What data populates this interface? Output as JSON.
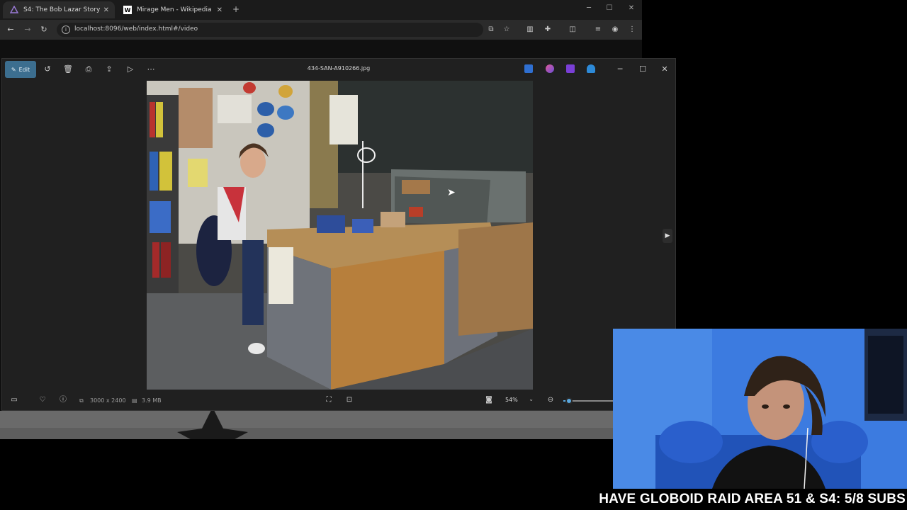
{
  "browser": {
    "tabs": [
      {
        "title": "S4: The Bob Lazar Story",
        "active": true,
        "favicon": "jellyfin-icon"
      },
      {
        "title": "Mirage Men - Wikipedia",
        "active": false,
        "favicon": "wikipedia-icon"
      }
    ],
    "url": "localhost:8096/web/index.html#/video"
  },
  "viewer": {
    "edit_label": "Edit",
    "filename": "434-SAN-A910266.jpg",
    "dimensions": "3000 x 2400",
    "filesize": "3.9 MB",
    "zoom": "54%",
    "zoom_slider_fraction": 0.1
  },
  "stream": {
    "caption": "HAVE GLOBOID RAID AREA 51 & S4: 5/8 SUBS"
  },
  "colors": {
    "accent": "#3c6e8f",
    "slider": "#5aa9e0",
    "webcam_bg": "#3e78d8"
  }
}
